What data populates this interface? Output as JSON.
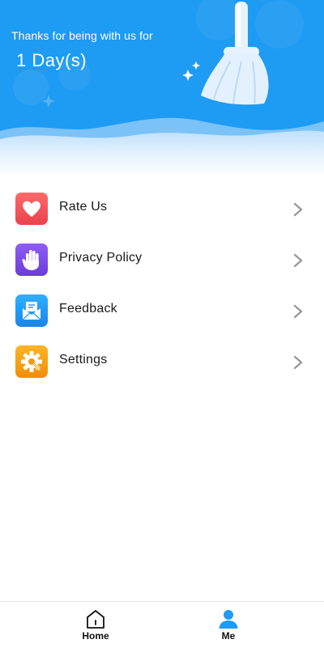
{
  "hero": {
    "thanks_text": "Thanks for being with us for",
    "days_text": "1 Day(s)",
    "background_color": "#1e9bf3",
    "illustration_icon": "broom-icon"
  },
  "menu": {
    "items": [
      {
        "label": "Rate Us",
        "icon": "heart-icon",
        "color": "#f2545b"
      },
      {
        "label": "Privacy Policy",
        "icon": "hand-icon",
        "color": "#7b4ce6"
      },
      {
        "label": "Feedback",
        "icon": "envelope-icon",
        "color": "#2196f3"
      },
      {
        "label": "Settings",
        "icon": "gear-icon",
        "color": "#f5a011"
      }
    ]
  },
  "bottom_nav": {
    "tabs": [
      {
        "label": "Home",
        "icon": "home-icon"
      },
      {
        "label": "Me",
        "icon": "profile-icon",
        "active": true,
        "active_color": "#1e9bf3"
      }
    ]
  }
}
